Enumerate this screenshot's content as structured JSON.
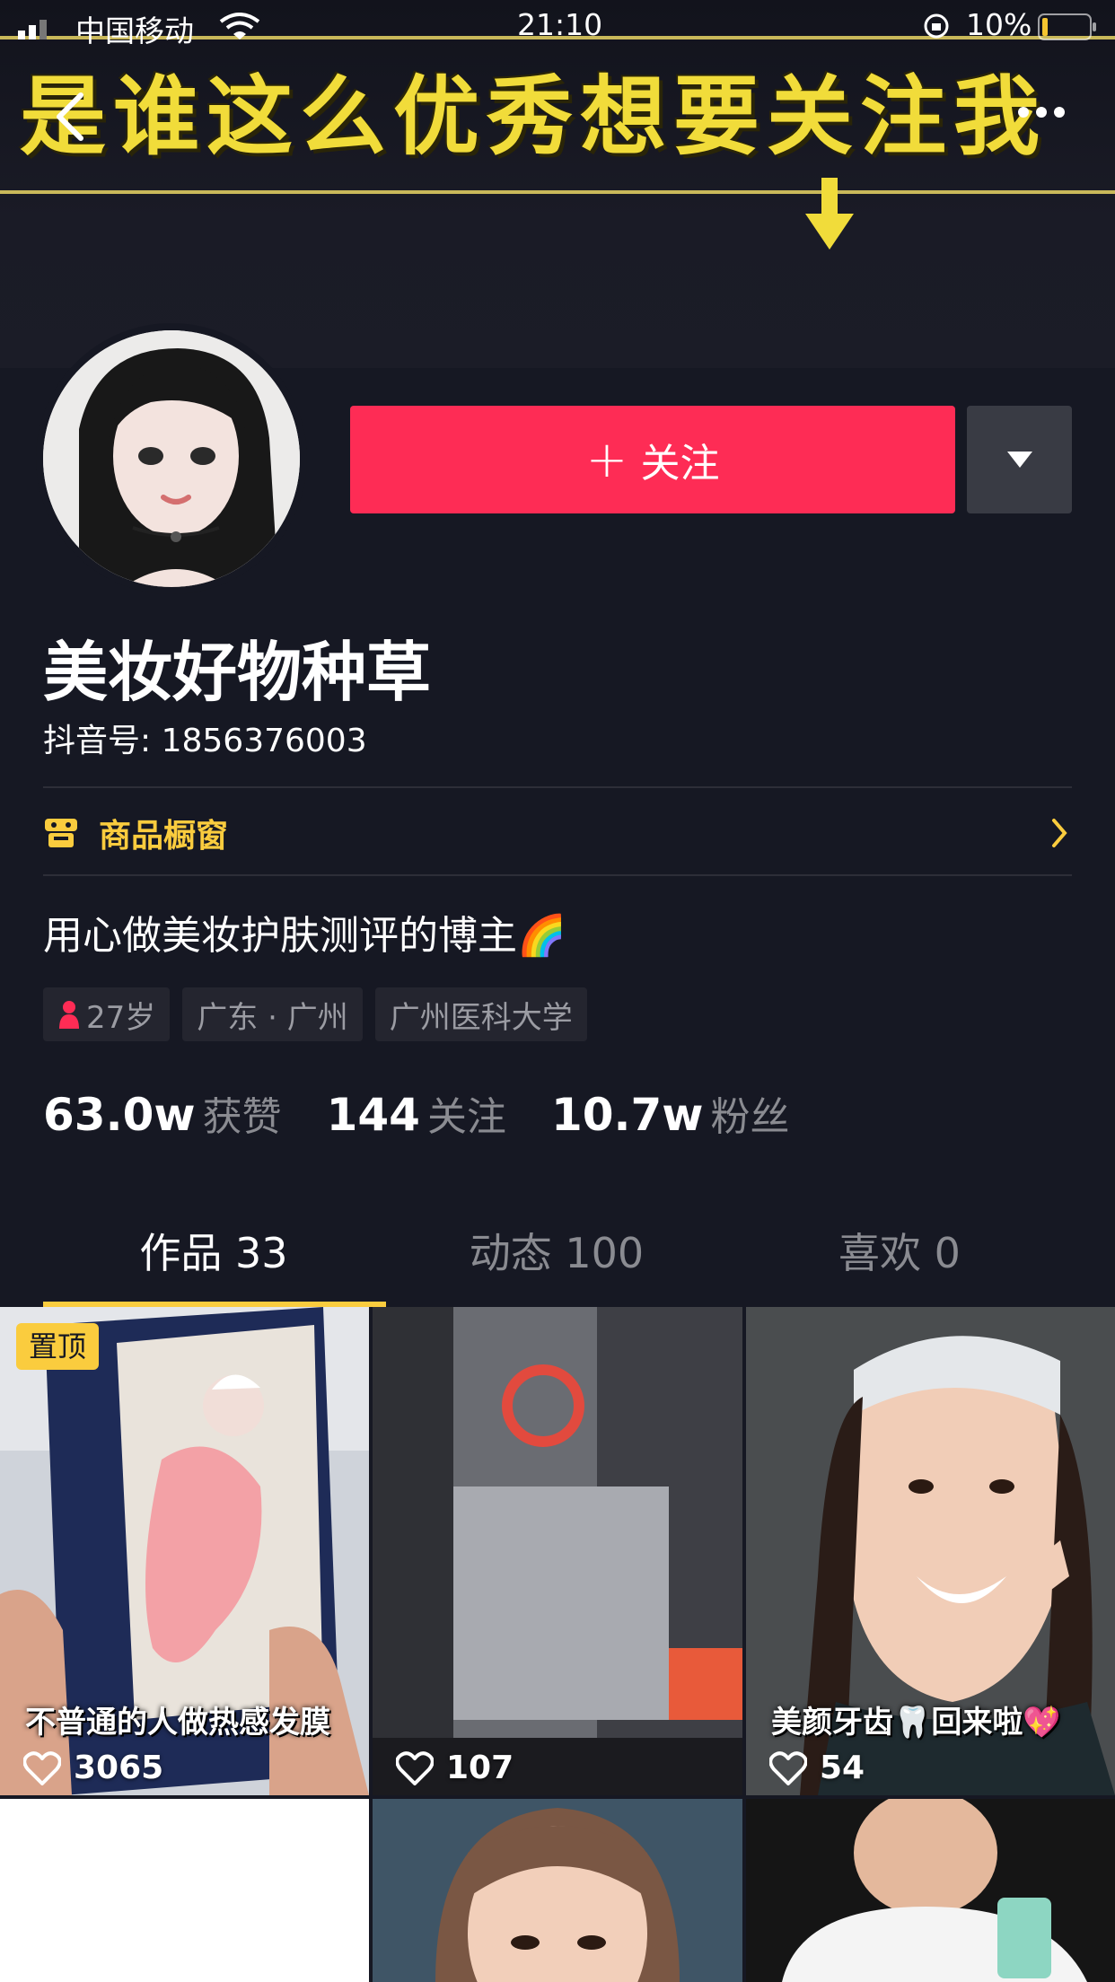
{
  "status_bar": {
    "carrier": "中国移动",
    "time": "21:10",
    "battery": "10%"
  },
  "banner": {
    "headline": "是谁这么优秀想要关注我"
  },
  "profile": {
    "follow_label": "关注",
    "nickname": "美妆好物种草",
    "douyin_id": "抖音号: 1856376003",
    "shop_label": "商品橱窗",
    "bio": "用心做美妆护肤测评的博主🌈",
    "tags": {
      "age": "27岁",
      "location": "广东 · 广州",
      "school": "广州医科大学"
    },
    "stats": [
      {
        "num": "63.0w",
        "label": "获赞"
      },
      {
        "num": "144",
        "label": "关注"
      },
      {
        "num": "10.7w",
        "label": "粉丝"
      }
    ]
  },
  "tabs": [
    {
      "label": "作品 33"
    },
    {
      "label": "动态 100"
    },
    {
      "label": "喜欢 0"
    }
  ],
  "videos": [
    {
      "pinned_label": "置顶",
      "caption": "不普通的人做热感发膜",
      "likes": "3065"
    },
    {
      "caption": "",
      "likes": "107"
    },
    {
      "caption": "美颜牙齿🦷回来啦💖",
      "likes": "54"
    }
  ],
  "colors": {
    "background": "#161823",
    "follow": "#fe2c55",
    "accent": "#facc3e"
  },
  "icons": {
    "back": "chevron-left-icon",
    "more": "more-icon",
    "dropdown": "caret-down-icon",
    "shop": "shop-icon",
    "shop_go": "chevron-right-icon",
    "gender": "female-icon",
    "likes": "heart-icon"
  }
}
